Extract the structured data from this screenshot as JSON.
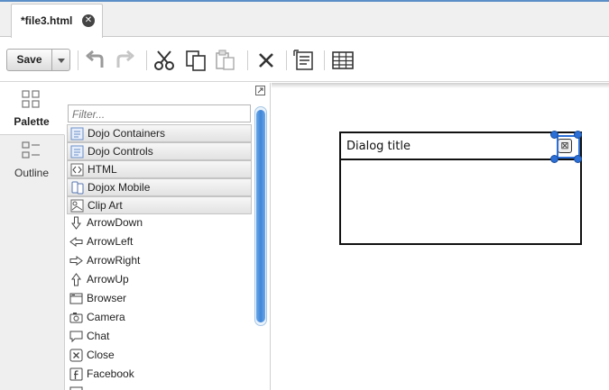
{
  "editor_tab": {
    "label": "*file3.html",
    "close_glyph": "✕"
  },
  "toolbar": {
    "save_label": "Save",
    "tools": [
      "undo-icon",
      "redo-icon",
      "cut-icon",
      "copy-icon",
      "paste-icon",
      "delete-icon",
      "source-icon",
      "table-icon"
    ]
  },
  "rail": {
    "palette_label": "Palette",
    "outline_label": "Outline"
  },
  "palette": {
    "filter_placeholder": "Filter...",
    "categories": [
      {
        "label": "Dojo Containers",
        "icon": "dijit-icon"
      },
      {
        "label": "Dojo Controls",
        "icon": "dijit-icon"
      },
      {
        "label": "HTML",
        "icon": "html-icon"
      },
      {
        "label": "Dojox Mobile",
        "icon": "mobile-icon"
      },
      {
        "label": "Clip Art",
        "icon": "clipart-icon"
      }
    ],
    "items": [
      {
        "label": "ArrowDown",
        "icon": "arrow-down-icon"
      },
      {
        "label": "ArrowLeft",
        "icon": "arrow-left-icon"
      },
      {
        "label": "ArrowRight",
        "icon": "arrow-right-icon"
      },
      {
        "label": "ArrowUp",
        "icon": "arrow-up-icon"
      },
      {
        "label": "Browser",
        "icon": "browser-icon"
      },
      {
        "label": "Camera",
        "icon": "camera-icon"
      },
      {
        "label": "Chat",
        "icon": "chat-icon"
      },
      {
        "label": "Close",
        "icon": "close-icon"
      },
      {
        "label": "Facebook",
        "icon": "facebook-icon"
      }
    ]
  },
  "canvas": {
    "dialog_title": "Dialog title",
    "dialog_close_glyph": "⊠"
  },
  "colors": {
    "accent": "#2c6fd6",
    "scroll": "#3f86d8"
  }
}
